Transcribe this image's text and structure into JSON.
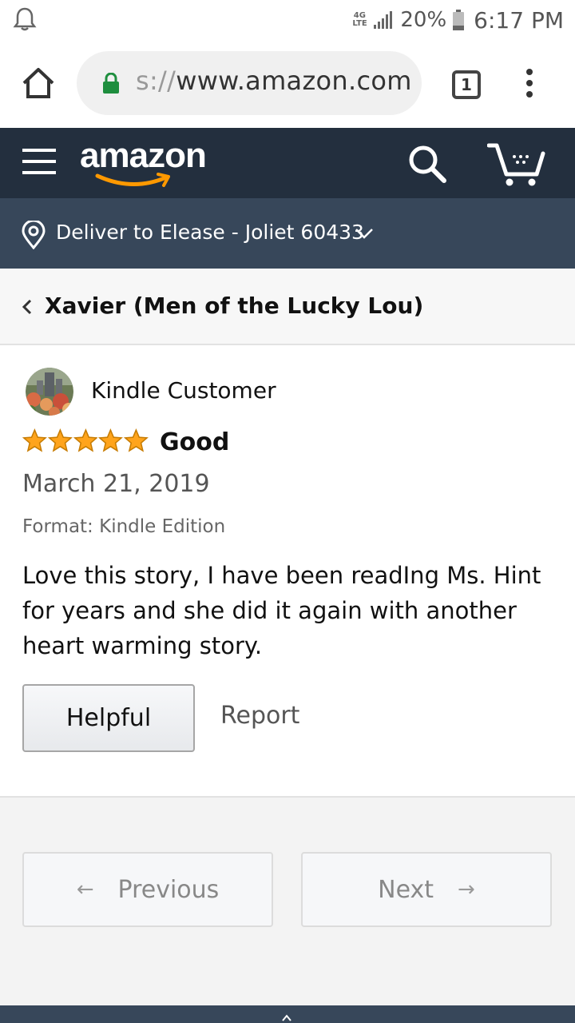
{
  "status_bar": {
    "network": "4G LTE",
    "battery_percent": "20%",
    "time": "6:17 PM",
    "icons": [
      "notification-bell-icon",
      "signal-icon",
      "battery-icon"
    ]
  },
  "browser": {
    "url_scheme": "s://",
    "url_host": "www.amazon.com",
    "tab_count": "1",
    "icons": [
      "home-icon",
      "lock-icon",
      "more-vert-icon"
    ],
    "lock_color": "#1e8e3e"
  },
  "header": {
    "logo_text": "amazon",
    "brand_color": "#232f3e",
    "smile_color": "#ff9900",
    "icons": [
      "hamburger-menu-icon",
      "search-icon",
      "cart-icon"
    ]
  },
  "deliver": {
    "text": "Deliver to Elease - Joliet 60433",
    "icons": [
      "location-pin-icon",
      "chevron-down-icon"
    ],
    "bar_color": "#37475a"
  },
  "breadcrumb": {
    "title": "Xavier (Men of the Lucky Lou)",
    "icon": "chevron-left-icon"
  },
  "review": {
    "reviewer_name": "Kindle Customer",
    "rating": 5,
    "rating_max": 5,
    "star_color": "#ffa41c",
    "title": "Good",
    "date": "March 21, 2019",
    "format": "Format: Kindle Edition",
    "body": "Love this story, I have been readIng Ms. Hint for years and she did it again with another heart warming story.",
    "helpful_label": "Helpful",
    "report_label": "Report"
  },
  "pagination": {
    "previous_label": "Previous",
    "next_label": "Next",
    "prev_arrow": "←",
    "next_arrow": "→"
  }
}
